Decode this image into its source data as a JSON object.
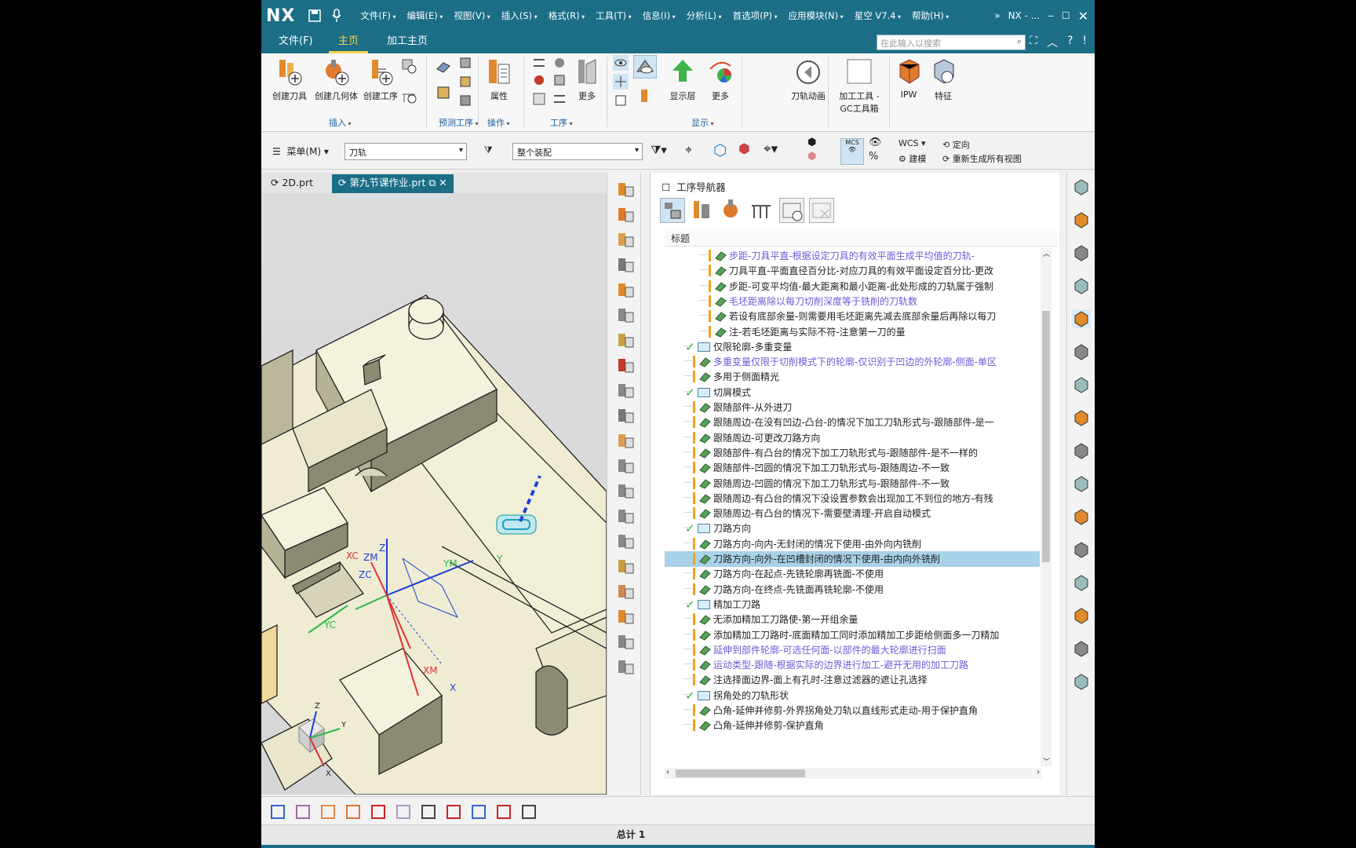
{
  "app": {
    "logo": "NX",
    "title": "NX - ...",
    "menus": [
      "文件(F)",
      "编辑(E)",
      "视图(V)",
      "插入(S)",
      "格式(R)",
      "工具(T)",
      "信息(I)",
      "分析(L)",
      "首选项(P)",
      "应用模块(N)",
      "星空 V7.4",
      "帮助(H)"
    ]
  },
  "ribbon_tabs": [
    {
      "label": "文件(F)"
    },
    {
      "label": "主页",
      "active": true
    },
    {
      "label": "加工主页"
    }
  ],
  "search": {
    "placeholder": "在此输入以搜索"
  },
  "ribbon": {
    "create_tool": "创建刀具",
    "create_geometry": "创建几何体",
    "create_operation": "创建工序",
    "attributes": "属性",
    "more1": "更多",
    "show_layer": "显示层",
    "more2": "更多",
    "toolpath_anim": "刀轨动画",
    "gc_toolbox_line1": "加工工具 -",
    "gc_toolbox_line2": "GC工具箱",
    "ipw": "IPW",
    "feature": "特征",
    "groups": {
      "insert": "插入",
      "predict": "预测工序",
      "operation": "操作",
      "procedure": "工序",
      "display": "显示"
    }
  },
  "toolbar2": {
    "menu": "菜单(M)",
    "filter": "刀轨",
    "assembly": "整个装配",
    "wcs": "WCS",
    "orient": "定向",
    "build": "建模",
    "regen": "重新生成所有视图"
  },
  "doc_tabs": [
    {
      "label": "2D.prt"
    },
    {
      "label": "第九节课作业.prt",
      "active": true
    }
  ],
  "viewport_labels": {
    "xc": "XC",
    "zm": "ZM",
    "z": "Z",
    "ym": "YM",
    "y": "Y",
    "zc": "ZC",
    "yc": "YC",
    "xm": "XM",
    "x": "X",
    "mini_z": "Z",
    "mini_y": "Y",
    "mini_x": "X"
  },
  "navigator": {
    "title": "工序导航器",
    "column": "标题",
    "rows": [
      {
        "text": "步距-刀具平直-根据设定刀具的有效平面生成平均值的刀轨-",
        "type": "op",
        "level": 2,
        "link": true
      },
      {
        "text": "刀具平直-平面直径百分比-对应刀具的有效平面设定百分比-更改",
        "type": "op",
        "level": 2
      },
      {
        "text": "步距-可变平均值-最大距离和最小距离-此处形成的刀轨属于强制",
        "type": "op",
        "level": 2
      },
      {
        "text": "毛坯距离除以每刀切削深度等于铣削的刀轨数",
        "type": "op",
        "level": 2,
        "link": true
      },
      {
        "text": "若设有底部余量-则需要用毛坯距离先减去底部余量后再除以每刀",
        "type": "op",
        "level": 2
      },
      {
        "text": "注-若毛坯距离与实际不符-注意第一刀的量",
        "type": "op",
        "level": 2
      },
      {
        "text": "仅限轮廓-多重变量",
        "type": "folder",
        "level": 1
      },
      {
        "text": "多重变量仅限于切削模式下的轮廓-仅识别于凹边的外轮廓-侧面-单区",
        "type": "op",
        "level": 1,
        "link": true
      },
      {
        "text": "多用于侧面精光",
        "type": "op",
        "level": 1
      },
      {
        "text": "切屑模式",
        "type": "folder",
        "level": 1
      },
      {
        "text": "跟随部件-从外进刀",
        "type": "op",
        "level": 1
      },
      {
        "text": "跟随周边-在没有凹边-凸台-的情况下加工刀轨形式与-跟随部件-是一",
        "type": "op",
        "level": 1
      },
      {
        "text": "跟随周边-可更改刀路方向",
        "type": "op",
        "level": 1
      },
      {
        "text": "跟随部件-有凸台的情况下加工刀轨形式与-跟随部件-是不一样的",
        "type": "op",
        "level": 1
      },
      {
        "text": "跟随部件-凹圆的情况下加工刀轨形式与-跟随周边-不一致",
        "type": "op",
        "level": 1
      },
      {
        "text": "跟随周边-凹圆的情况下加工刀轨形式与-跟随部件-不一致",
        "type": "op",
        "level": 1
      },
      {
        "text": "跟随周边-有凸台的情况下没设置参数会出现加工不到位的地方-有残",
        "type": "op",
        "level": 1
      },
      {
        "text": "跟随周边-有凸台的情况下-需要壁清理-开启自动模式",
        "type": "op",
        "level": 1
      },
      {
        "text": "刀路方向",
        "type": "folder",
        "level": 1
      },
      {
        "text": "刀路方向-向内-无封闭的情况下使用-由外向内铣削",
        "type": "op",
        "level": 1
      },
      {
        "text": "刀路方向-向外-在凹槽封闭的情况下使用-由内向外铣削",
        "type": "op",
        "level": 1,
        "selected": true
      },
      {
        "text": "刀路方向-在起点-先铣轮廓再铣面-不使用",
        "type": "op",
        "level": 1
      },
      {
        "text": "刀路方向-在终点-先铣面再铣轮廓-不使用",
        "type": "op",
        "level": 1
      },
      {
        "text": "精加工刀路",
        "type": "folder",
        "level": 1
      },
      {
        "text": "无添加精加工刀路使-第一开组余量",
        "type": "op",
        "level": 1
      },
      {
        "text": "添加精加工刀路时-底面精加工同时添加精加工步距给侧面多一刀精加",
        "type": "op",
        "level": 1
      },
      {
        "text": "延伸到部件轮廓-可选任何面-以部件的最大轮廓进行扫面",
        "type": "op",
        "level": 1,
        "link": true
      },
      {
        "text": "运动类型-跟随-根据实际的边界进行加工-避开无用的加工刀路",
        "type": "op",
        "level": 1,
        "link": true
      },
      {
        "text": "注选择面边界-面上有孔时-注意过滤器的遮让孔选择",
        "type": "op",
        "level": 1
      },
      {
        "text": "拐角处的刀轨形状",
        "type": "folder",
        "level": 1
      },
      {
        "text": "凸角-延伸并修剪-外界拐角处刀轨以直线形式走动-用于保护直角",
        "type": "op",
        "level": 1
      },
      {
        "text": "凸角-延伸并修剪-保护直角",
        "type": "op",
        "level": 1
      }
    ]
  },
  "status": {
    "total": "总计 1"
  },
  "colors": {
    "titlebar": "#1b6e86",
    "accent_tab": "#ffd24a",
    "selection": "#a8d2e8",
    "check": "#2fb344",
    "link": "#6b5ad8",
    "model": "#f2efd8"
  }
}
